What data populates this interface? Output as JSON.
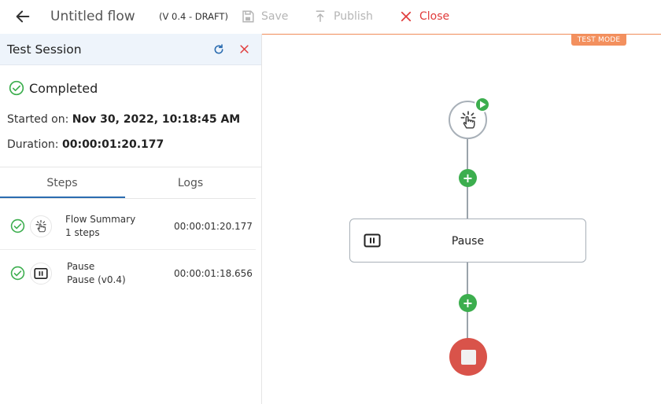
{
  "header": {
    "title": "Untitled flow",
    "version": "(V 0.4 - DRAFT)",
    "save_label": "Save",
    "publish_label": "Publish",
    "close_label": "Close",
    "test_mode_badge": "TEST MODE"
  },
  "session": {
    "title": "Test Session",
    "status": "Completed",
    "started_label": "Started on:",
    "started_value": "Nov 30, 2022, 10:18:45 AM",
    "duration_label": "Duration:",
    "duration_value": "00:00:01:20.177"
  },
  "tabs": [
    {
      "label": "Steps",
      "active": true
    },
    {
      "label": "Logs",
      "active": false
    }
  ],
  "steps": [
    {
      "name": "Flow Summary",
      "sub": "1 steps",
      "time": "00:00:01:20.177",
      "icon": "pointer-click-icon"
    },
    {
      "name": "Pause",
      "sub": "Pause (v0.4)",
      "time": "00:00:01:18.656",
      "icon": "pause-icon"
    }
  ],
  "canvas": {
    "pause_node_label": "Pause",
    "add_symbol": "+"
  },
  "colors": {
    "accent_blue": "#2b6cb0",
    "success_green": "#3cae4e",
    "danger_red": "#e03b3b",
    "test_orange": "#f3905e",
    "end_node_red": "#d9534a"
  }
}
